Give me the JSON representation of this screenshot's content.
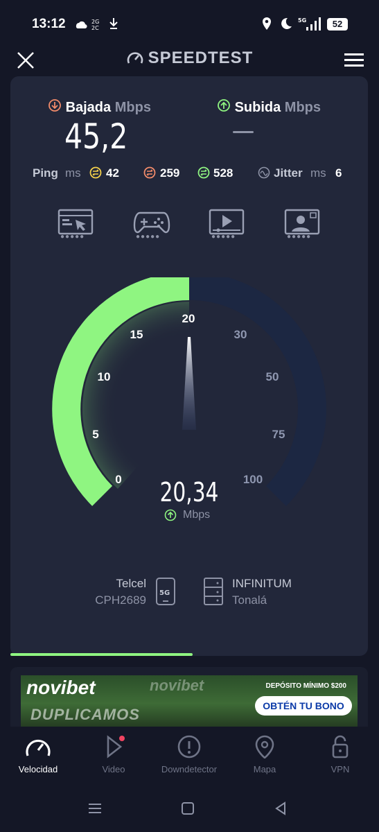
{
  "status_bar": {
    "time": "13:12",
    "left_icons": [
      "weather-icon",
      "dual-sim-icon",
      "download-icon"
    ],
    "right_icons": [
      "location-icon",
      "dnd-moon-icon",
      "5g-signal-icon",
      "battery-icon"
    ],
    "network_label": "5G",
    "battery": "52"
  },
  "header": {
    "title": "SPEEDTEST",
    "close_icon": "close-icon",
    "menu_icon": "hamburger-icon"
  },
  "download": {
    "label": "Bajada",
    "unit": "Mbps",
    "value": "45,2",
    "icon": "download-circle-icon"
  },
  "upload": {
    "label": "Subida",
    "unit": "Mbps",
    "value": "—",
    "icon": "upload-circle-icon"
  },
  "ping": {
    "label": "Ping",
    "unit": "ms",
    "idle": "42",
    "download": "259",
    "upload": "528"
  },
  "jitter": {
    "label": "Jitter",
    "unit": "ms",
    "value": "6"
  },
  "experience_icons": [
    {
      "name": "web-browsing-icon"
    },
    {
      "name": "gaming-icon"
    },
    {
      "name": "video-streaming-icon"
    },
    {
      "name": "video-call-icon"
    }
  ],
  "gauge": {
    "current_value": "20,34",
    "unit": "Mbps",
    "ticks": [
      "0",
      "5",
      "10",
      "15",
      "20",
      "30",
      "50",
      "75",
      "100"
    ],
    "accent": "#8ff581",
    "track": "#1c2742"
  },
  "connection": {
    "carrier": "Telcel",
    "device": "CPH2689",
    "network_badge": "5G",
    "server_name": "INFINITUM",
    "server_location": "Tonalá"
  },
  "progress": 0.51,
  "ad": {
    "brand": "novibet",
    "deposit": "DEPÓSITO MÍNIMO $200",
    "cta": "OBTÉN TU BONO",
    "slogan": "DUPLICAMOS"
  },
  "bottom_nav": [
    {
      "label": "Velocidad",
      "icon": "speedometer-icon",
      "active": true
    },
    {
      "label": "Video",
      "icon": "play-icon",
      "active": false
    },
    {
      "label": "Downdetector",
      "icon": "alert-icon",
      "active": false
    },
    {
      "label": "Mapa",
      "icon": "map-pin-icon",
      "active": false
    },
    {
      "label": "VPN",
      "icon": "unlock-icon",
      "active": false
    }
  ],
  "colors": {
    "background": "#141726",
    "card": "#22273a",
    "download_accent": "#f28b6a",
    "upload_accent": "#8ff581",
    "ping_idle": "#f4d04b"
  }
}
